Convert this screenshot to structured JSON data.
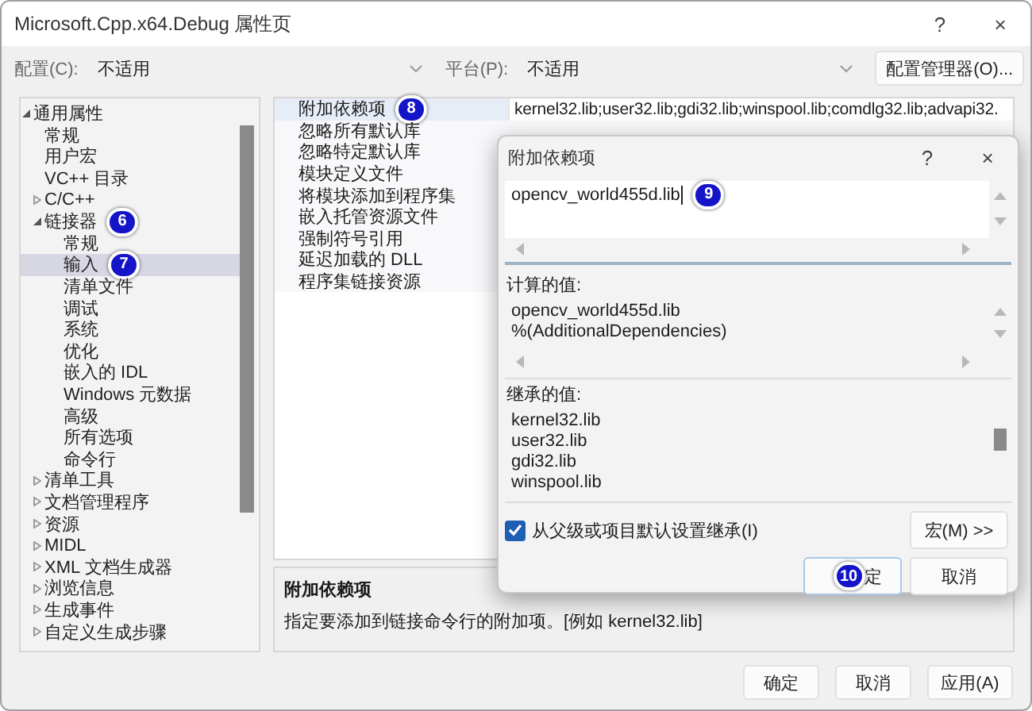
{
  "window": {
    "title": "Microsoft.Cpp.x64.Debug 属性页",
    "help": "?",
    "close": "×"
  },
  "toolbar": {
    "config_label": "配置(C):",
    "config_value": "不适用",
    "platform_label": "平台(P):",
    "platform_value": "不适用",
    "manager_button": "配置管理器(O)..."
  },
  "tree": [
    {
      "label": "通用属性",
      "expanded": true,
      "selected": false,
      "children": [
        {
          "label": "常规",
          "selected": false
        },
        {
          "label": "用户宏",
          "selected": false
        },
        {
          "label": "VC++ 目录",
          "selected": false
        },
        {
          "label": "C/C++",
          "expanded": false,
          "selected": false
        },
        {
          "label": "链接器",
          "expanded": true,
          "selected": false,
          "badge": "6",
          "children": [
            {
              "label": "常规",
              "selected": false
            },
            {
              "label": "输入",
              "selected": true,
              "badge": "7"
            },
            {
              "label": "清单文件",
              "selected": false
            },
            {
              "label": "调试",
              "selected": false
            },
            {
              "label": "系统",
              "selected": false
            },
            {
              "label": "优化",
              "selected": false
            },
            {
              "label": "嵌入的 IDL",
              "selected": false
            },
            {
              "label": "Windows 元数据",
              "selected": false
            },
            {
              "label": "高级",
              "selected": false
            },
            {
              "label": "所有选项",
              "selected": false
            },
            {
              "label": "命令行",
              "selected": false
            }
          ]
        },
        {
          "label": "清单工具",
          "expanded": false,
          "selected": false
        },
        {
          "label": "文档管理程序",
          "expanded": false,
          "selected": false
        },
        {
          "label": "资源",
          "expanded": false,
          "selected": false
        },
        {
          "label": "MIDL",
          "expanded": false,
          "selected": false
        },
        {
          "label": "XML 文档生成器",
          "expanded": false,
          "selected": false
        },
        {
          "label": "浏览信息",
          "expanded": false,
          "selected": false
        },
        {
          "label": "生成事件",
          "expanded": false,
          "selected": false
        },
        {
          "label": "自定义生成步骤",
          "expanded": false,
          "selected": false
        }
      ]
    }
  ],
  "properties": [
    {
      "name": "附加依赖项",
      "value": "kernel32.lib;user32.lib;gdi32.lib;winspool.lib;comdlg32.lib;advapi32.",
      "selected": true,
      "badge": "8"
    },
    {
      "name": "忽略所有默认库",
      "selected": false
    },
    {
      "name": "忽略特定默认库",
      "selected": false
    },
    {
      "name": "模块定义文件",
      "selected": false
    },
    {
      "name": "将模块添加到程序集",
      "selected": false
    },
    {
      "name": "嵌入托管资源文件",
      "selected": false
    },
    {
      "name": "强制符号引用",
      "selected": false
    },
    {
      "name": "延迟加载的 DLL",
      "selected": false
    },
    {
      "name": "程序集链接资源",
      "selected": false
    }
  ],
  "description": {
    "title": "附加依赖项",
    "text": "指定要添加到链接命令行的附加项。[例如 kernel32.lib]"
  },
  "buttons": [
    {
      "label": "确定"
    },
    {
      "label": "取消"
    },
    {
      "label": "应用(A)"
    }
  ],
  "dialog": {
    "title": "附加依赖项",
    "help": "?",
    "close": "×",
    "edit": {
      "value": "opencv_world455d.lib",
      "badge": "9"
    },
    "computed_label": "计算的值:",
    "computed": [
      "opencv_world455d.lib",
      "%(AdditionalDependencies)"
    ],
    "inherited_label": "继承的值:",
    "inherited": [
      "kernel32.lib",
      "user32.lib",
      "gdi32.lib",
      "winspool.lib"
    ],
    "inherit_checkbox": {
      "label": "从父级或项目默认设置继承(I)",
      "checked": true
    },
    "macro_button": "宏(M) >>",
    "buttons": [
      {
        "label": "定",
        "badge": "10"
      },
      {
        "label": "取消"
      }
    ]
  }
}
